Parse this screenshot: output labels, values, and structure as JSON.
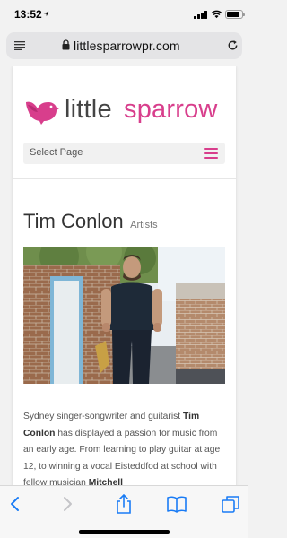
{
  "status": {
    "time": "13:52",
    "battery_level": 0.85
  },
  "browser": {
    "url": "littlesparrowpr.com"
  },
  "site": {
    "logo_part1": "little",
    "logo_part2": "sparrow",
    "nav_label": "Select Page",
    "brand_color": "#d83e8c"
  },
  "article": {
    "title": "Tim Conlon",
    "category": "Artists",
    "paragraph": [
      {
        "text": "Sydney singer-songwriter and guitarist ",
        "bold": false
      },
      {
        "text": "Tim Conlon",
        "bold": true
      },
      {
        "text": " has displayed a passion for music from an early age. From learning to play guitar at age 12, to winning a vocal Eisteddfod at school with fellow musician ",
        "bold": false
      },
      {
        "text": "Mitchell",
        "bold": true
      }
    ]
  },
  "icons": {
    "location": "location-arrow-icon",
    "signal": "cellular-signal-icon",
    "wifi": "wifi-icon",
    "battery": "battery-icon",
    "reader": "reader-mode-icon",
    "lock": "lock-icon",
    "reload": "reload-icon",
    "back": "back-arrow-icon",
    "forward": "forward-arrow-icon",
    "share": "share-icon",
    "bookmarks": "bookmarks-icon",
    "tabs": "tabs-icon",
    "menu": "hamburger-menu-icon",
    "logo_bird": "sparrow-bird-icon"
  }
}
